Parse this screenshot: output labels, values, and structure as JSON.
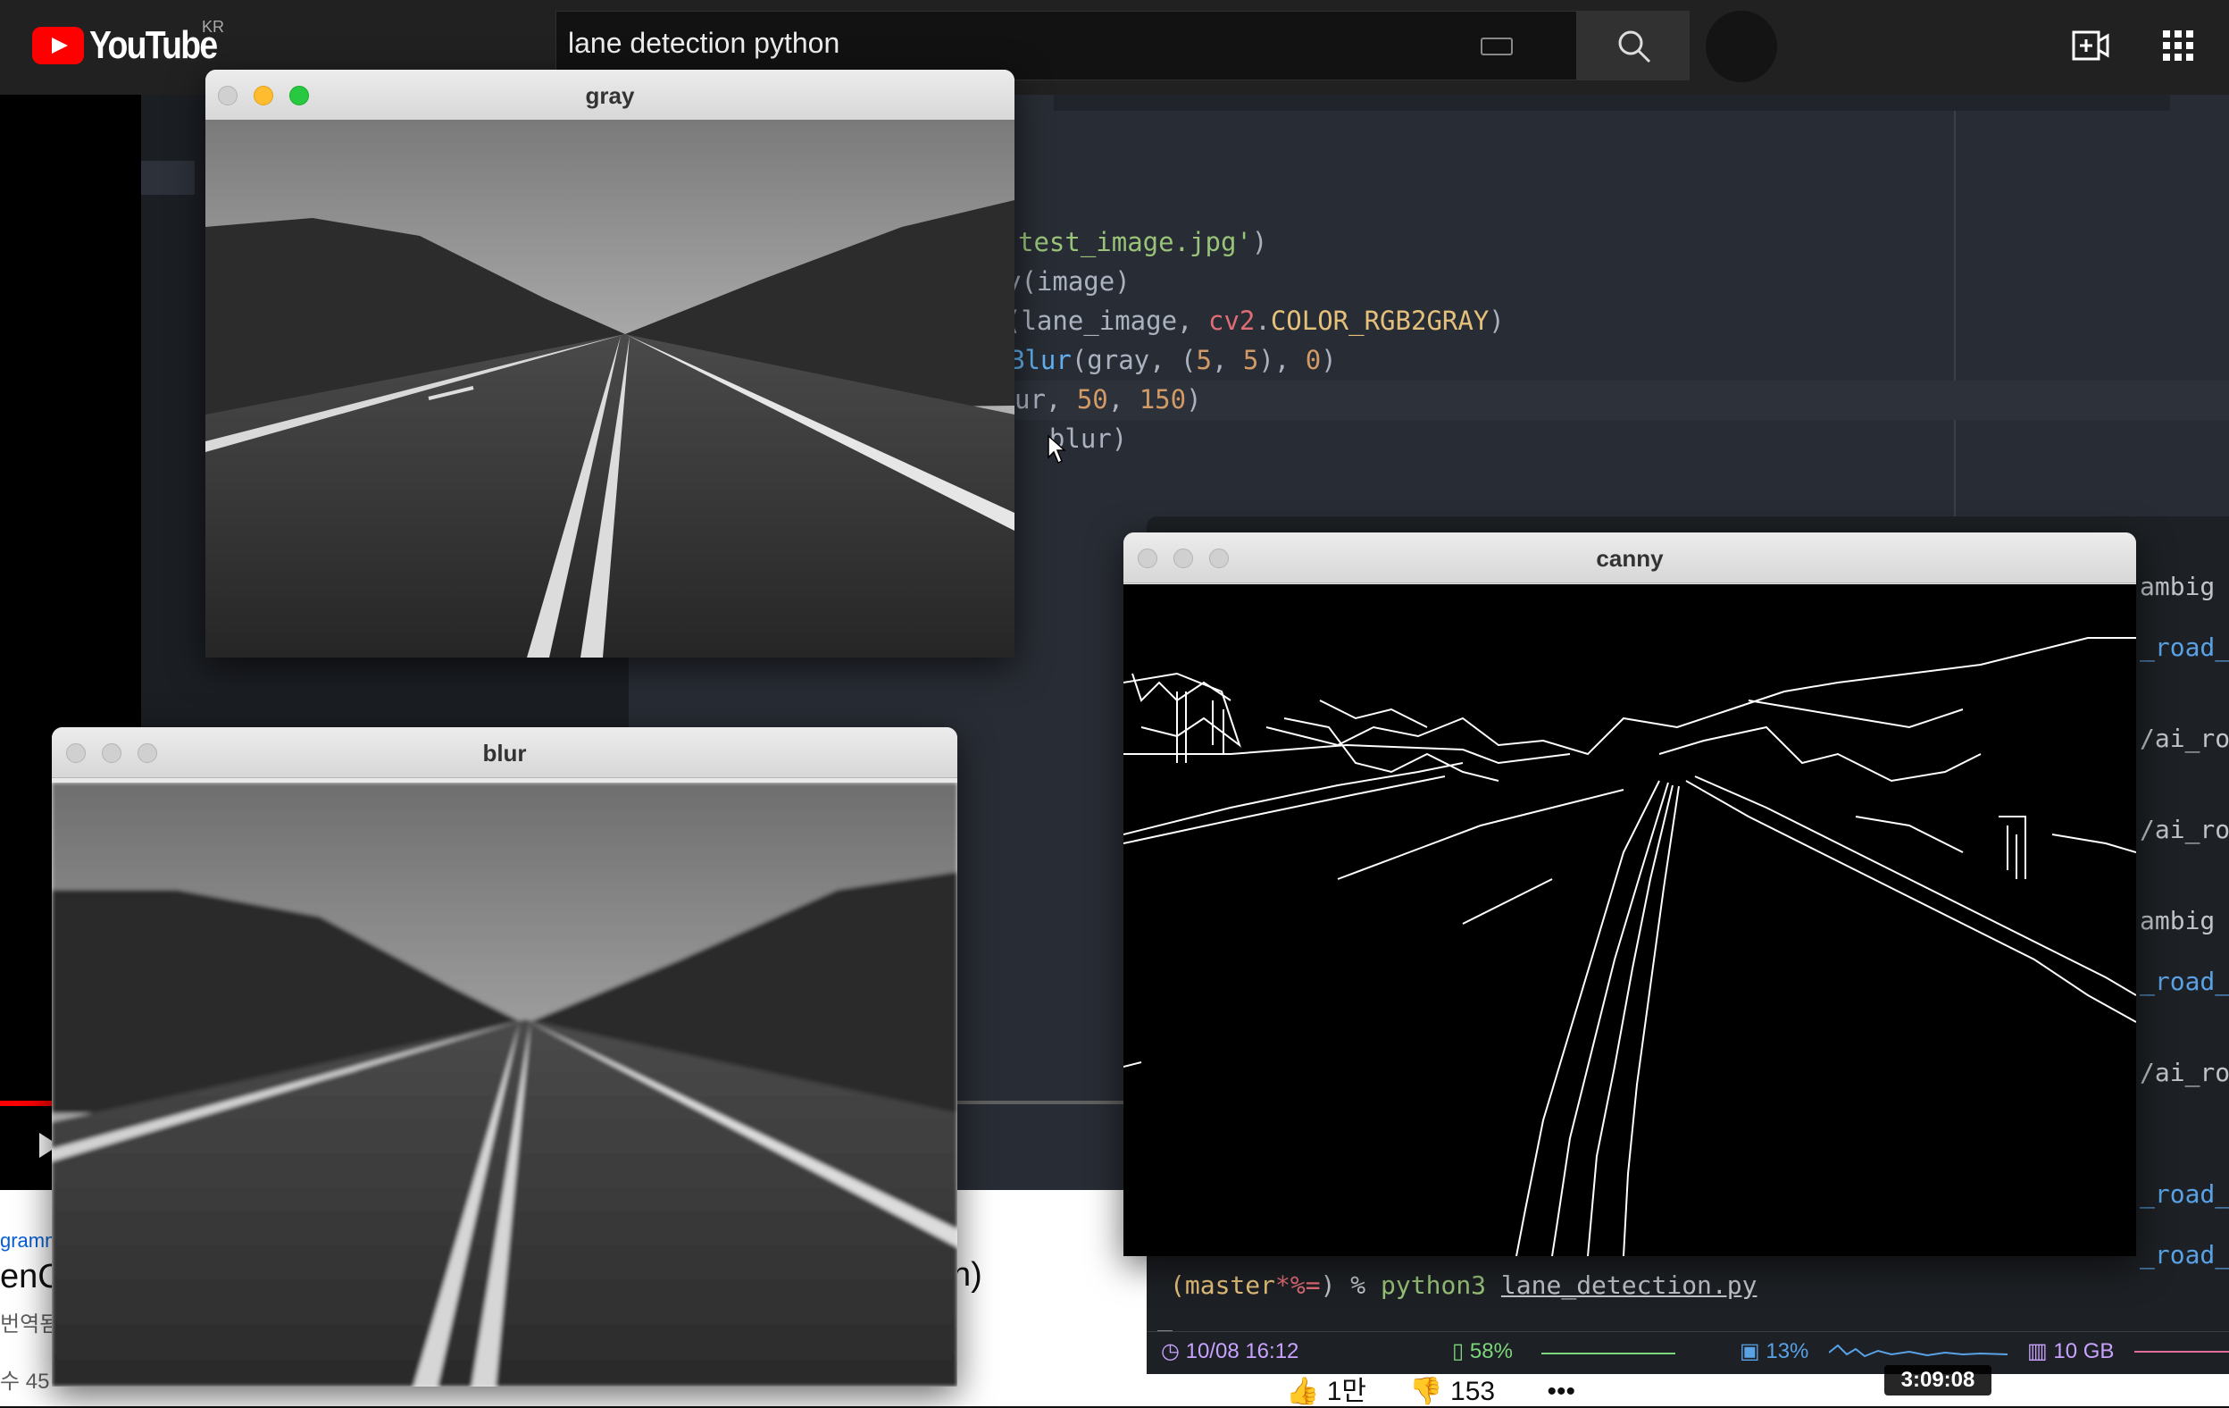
{
  "youtube": {
    "wordmark": "YouTube",
    "region": "KR",
    "search_value": "lane detection python",
    "meta_left_1": "gramm",
    "meta_left_2": "enCV",
    "meta_left_3": "번역됨",
    "meta_left_4": "수 45",
    "meta_right": "h)",
    "likes": "1만",
    "dislikes": "153",
    "more": "•••",
    "duration": "3:09:08"
  },
  "editor": {
    "lines": [
      {
        "pre": "",
        "str": "test_image.jpg'",
        "post": ")"
      },
      {
        "pre": "y(image)",
        "str": "",
        "post": ""
      },
      {
        "pre": "(lane_image, ",
        "mod": "cv2",
        "post": ".",
        "const": "COLOR_RGB2GRAY",
        "end": ")"
      },
      {
        "fn": "Blur",
        "pre": "(gray, (",
        "n1": "5",
        "sep": ", ",
        "n2": "5",
        "mid": "), ",
        "n3": "0",
        "end": ")"
      },
      {
        "pre": "ur, ",
        "n1": "50",
        "sep": ", ",
        "n2": "150",
        "end": ")"
      },
      {
        "pre": "  blur)"
      }
    ]
  },
  "windows": {
    "gray": {
      "title": "gray"
    },
    "blur": {
      "title": "blur"
    },
    "canny": {
      "title": "canny"
    }
  },
  "terminal": {
    "side_lines": [
      "ambig",
      "_road_d",
      "/ai_ro",
      "/ai_ro",
      "ambig",
      "_road_d",
      "/ai_ro",
      "_road_d",
      "_road_d"
    ],
    "prompt_branch": "(master",
    "prompt_flags": "*%=",
    "prompt_tail": ") % ",
    "command": "python3",
    "argument": "lane_detection.py",
    "cursor": "_",
    "status": {
      "datetime": "10/08 16:12",
      "battery": "58%",
      "cpu": "13%",
      "memory": "10 GB"
    }
  },
  "colors": {
    "youtube_red": "#ff0000",
    "editor_bg": "#282c34",
    "string_green": "#98c379",
    "number_orange": "#d19a66",
    "function_blue": "#61afef"
  }
}
